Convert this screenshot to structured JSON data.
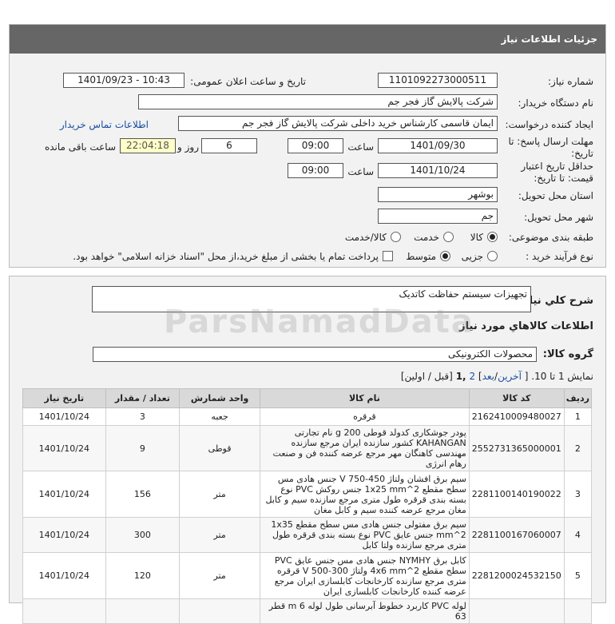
{
  "header": {
    "title": "جزئیات اطلاعات نیاز"
  },
  "form": {
    "need_number_label": "شماره نیاز:",
    "need_number": "1101092273000511",
    "announce_label": "تاریخ و ساعت اعلان عمومی:",
    "announce_value": "1401/09/23 - 10:43",
    "buyer_label": "نام دستگاه خریدار:",
    "buyer": "شرکت پالایش گاز فجر جم",
    "creator_label": "ایجاد کننده درخواست:",
    "creator": "ایمان قاسمی کارشناس خرید داخلی شرکت پالایش گاز فجر جم",
    "contact_link": "اطلاعات تماس خریدار",
    "deadline_label_1": "مهلت ارسال پاسخ: تا",
    "deadline_label_2": "تاریخ:",
    "deadline_date": "1401/09/30",
    "time_label": "ساعت",
    "deadline_time": "09:00",
    "days_value": "6",
    "days_label": "روز و",
    "remaining_time": "22:04:18",
    "remaining_label": "ساعت باقی مانده",
    "validity_label_1": "حداقل تاریخ اعتبار",
    "validity_label_2": "قیمت: تا تاریخ:",
    "validity_date": "1401/10/24",
    "validity_time": "09:00",
    "province_label": "استان محل تحویل:",
    "province": "بوشهر",
    "city_label": "شهر محل تحویل:",
    "city": "جم",
    "category_label": "طبقه بندی موضوعی:",
    "cat_goods": "کالا",
    "cat_service": "خدمت",
    "cat_goods_service": "کالا/خدمت",
    "process_label": "نوع فرآیند خرید :",
    "proc_partial": "جزیی",
    "proc_medium": "متوسط",
    "payment_note": "پرداخت تمام یا بخشی از مبلغ خرید،از محل \"اسناد خزانه اسلامی\" خواهد بود."
  },
  "details": {
    "summary_label": "شرح کلي نياز:",
    "summary": "تجهیزات سیستم حفاظت کاتدیک",
    "goods_info_title": "اطلاعات کالاهاي مورد نياز",
    "group_label": "گروه کالا:",
    "group_value": "محصولات الکترونیکی",
    "pager_text": "نمایش 1 تا 10. [",
    "pager_last": "آخرین",
    "pager_next": "بعد",
    "pager_page2": "2",
    "pager_current": ",1",
    "pager_rest": "[قبل / اولین]"
  },
  "table": {
    "headers": [
      "ردیف",
      "کد کالا",
      "نام کالا",
      "واحد شمارش",
      "تعداد / مقدار",
      "تاریخ نیاز"
    ],
    "rows": [
      {
        "row": "1",
        "code": "2162410009480027",
        "name": "قرقره",
        "unit": "جعبه",
        "qty": "3",
        "date": "1401/10/24"
      },
      {
        "row": "2",
        "code": "2552731365000001",
        "name": "پودر جوشکاری کدولد قوطی 200 g نام تجارتی KAHANGAN کشور سازنده ایران مرجع سازنده مهندسی کاهنگان مهر مرجع عرضه کننده فن و صنعت رهام انرژی",
        "unit": "قوطی",
        "qty": "9",
        "date": "1401/10/24"
      },
      {
        "row": "3",
        "code": "2281100140190022",
        "name": "سیم برق افشان ولتاژ 450-750 V جنس هادی مس سطح مقطع 1x25 mm^2 جنس روکش PVC نوع بسته بندی قرقره طول متری مرجع سازنده سیم و کابل مغان مرجع عرضه کننده سیم و کابل مغان",
        "unit": "متر",
        "qty": "156",
        "date": "1401/10/24"
      },
      {
        "row": "4",
        "code": "2281100167060007",
        "name": "سیم برق مفتولی جنس هادی مس سطح مقطع 1x35 mm^2 جنس عایق PVC نوع بسته بندی قرقره طول متری مرجع سازنده ولتا کابل",
        "unit": "متر",
        "qty": "300",
        "date": "1401/10/24"
      },
      {
        "row": "5",
        "code": "2281200024532150",
        "name": "کابل برق NYMHY جنس هادی مس جنس عایق PVC سطح مقطع 4x6 mm^2 ولتاژ 300-500 V قرقره متری مرجع سازنده کارخانجات کابلسازی ایران مرجع عرضه کننده کارخانجات کابلسازی ایران",
        "unit": "متر",
        "qty": "120",
        "date": "1401/10/24"
      },
      {
        "row": "",
        "code": "",
        "name": "لوله PVC کاربرد خطوط آبرسانی طول لوله 6 m قطر 63",
        "unit": "",
        "qty": "",
        "date": ""
      }
    ]
  }
}
